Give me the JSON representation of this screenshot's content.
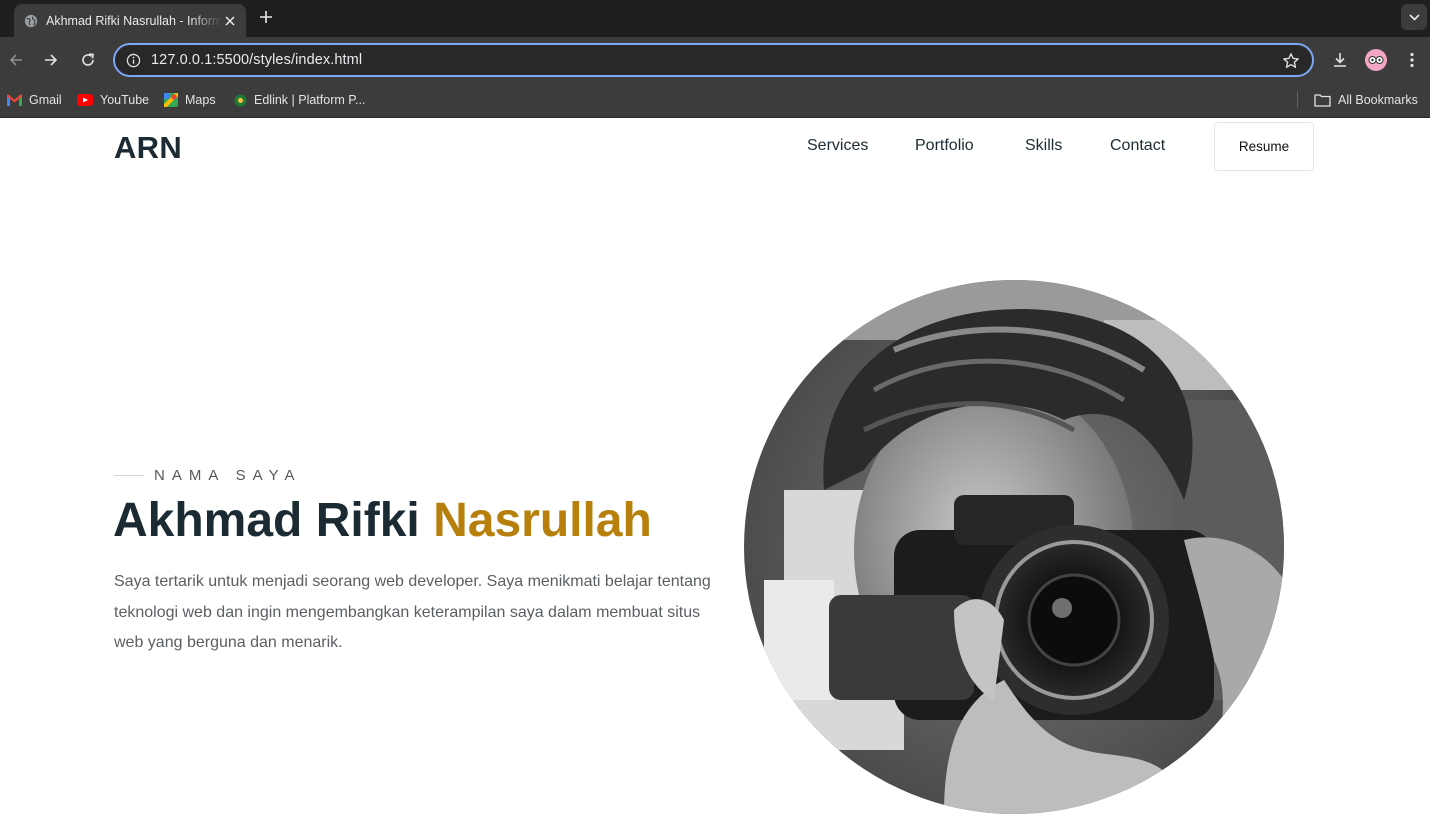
{
  "browser": {
    "tab_title": "Akhmad Rifki Nasrullah - Informatika",
    "url": "127.0.0.1:5500/styles/index.html",
    "bookmarks": [
      {
        "label": "Gmail",
        "icon": "gmail-icon"
      },
      {
        "label": "YouTube",
        "icon": "youtube-icon"
      },
      {
        "label": "Maps",
        "icon": "maps-icon"
      },
      {
        "label": "Edlink | Platform P...",
        "icon": "edlink-icon"
      }
    ],
    "all_bookmarks_label": "All Bookmarks"
  },
  "site": {
    "logo": "ARN",
    "nav": [
      {
        "label": "Services"
      },
      {
        "label": "Portfolio"
      },
      {
        "label": "Skills"
      },
      {
        "label": "Contact"
      }
    ],
    "resume_label": "Resume"
  },
  "hero": {
    "eyebrow": "NAMA SAYA",
    "name_first": "Akhmad Rifki",
    "name_accent": "Nasrullah",
    "description": "Saya tertarik untuk menjadi seorang web developer. Saya menikmati belajar tentang teknologi web dan ingin mengembangkan keterampilan saya dalam membuat situs web yang berguna dan menarik.",
    "photo": "profile-photo"
  },
  "colors": {
    "accent": "#b7800d",
    "heading": "#1c2b33",
    "body_text": "#5a5f63",
    "omnibox_focus": "#7ca7f5"
  }
}
